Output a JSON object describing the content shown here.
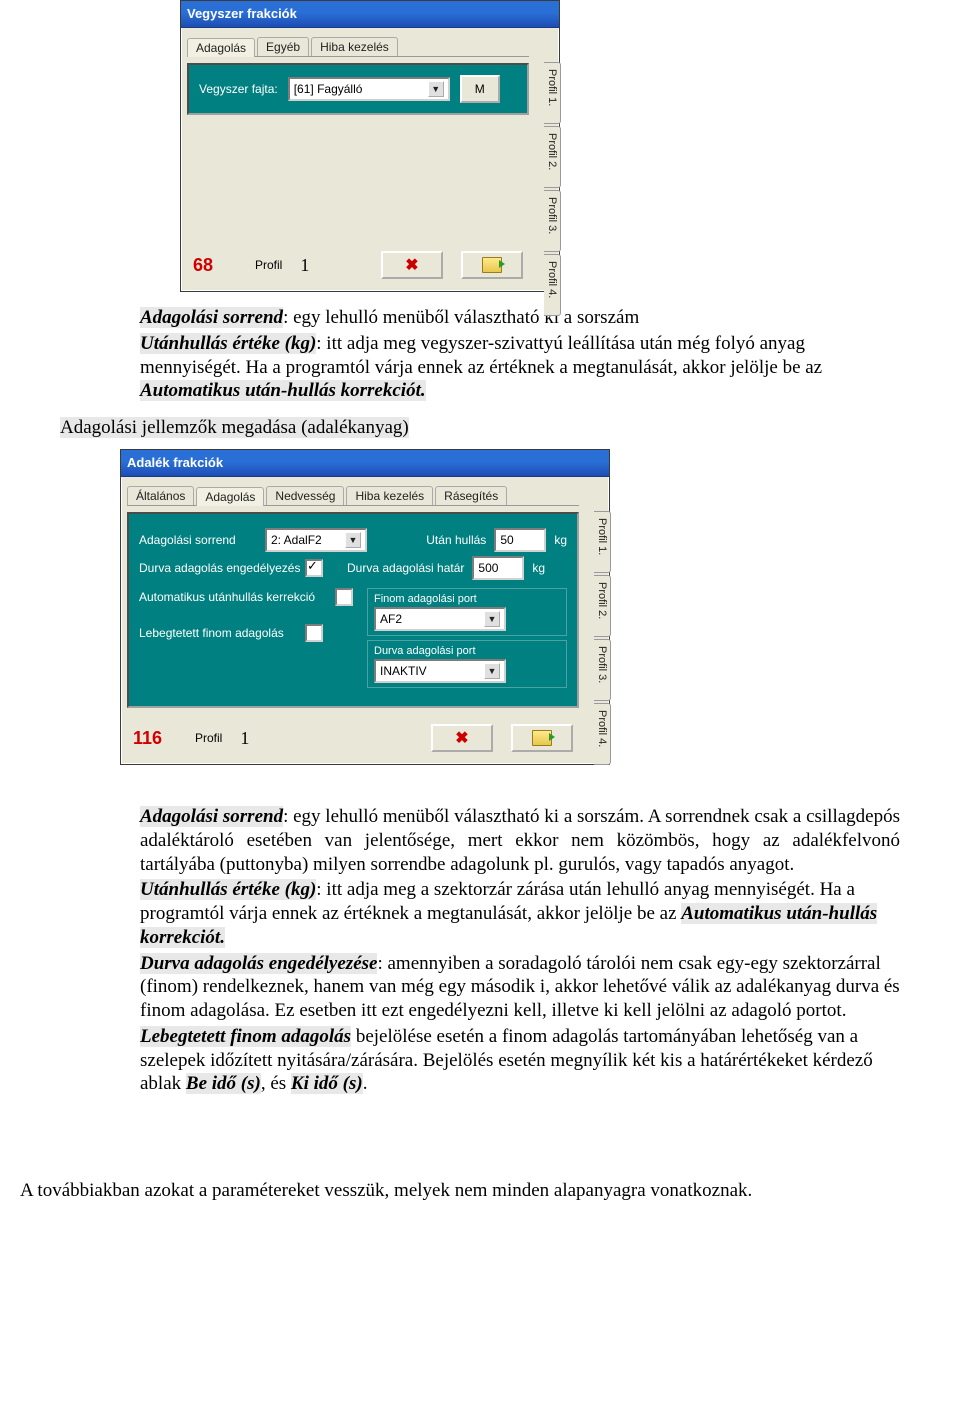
{
  "dialog1": {
    "title": "Vegyszer frakciók",
    "tabs": [
      "Adagolás",
      "Egyéb",
      "Hiba kezelés"
    ],
    "active_tab": 0,
    "field_label": "Vegyszer fajta:",
    "select_value": "[61] Fagyálló",
    "m_button": "M",
    "side_tabs": [
      "Profil 1.",
      "Profil 2.",
      "Profil 3.",
      "Profil 4."
    ],
    "footer_num": "68",
    "footer_profil_label": "Profil",
    "footer_profil_value": "1"
  },
  "para1": {
    "t1a": "Adagolási sorrend",
    "t1b": ": egy lehulló menüből választható ki a sorszám",
    "t2a": "Utánhullás értéke (kg)",
    "t2b": ": itt adja meg vegyszer-szivattyú leállítása után még folyó anyag mennyiségét.",
    "t3a": "Ha a programtól várja ennek az értéknek a megtanulását, akkor jelölje be az ",
    "t3b": "Automatikus után-hullás korrekciót."
  },
  "heading2": "Adagolási jellemzők megadása (adalékanyag)",
  "dialog2": {
    "title": "Adalék frakciók",
    "tabs": [
      "Általános",
      "Adagolás",
      "Nedvesség",
      "Hiba kezelés",
      "Rásegítés"
    ],
    "active_tab": 1,
    "labels": {
      "adag_sorrend": "Adagolási sorrend",
      "utan_hullas": "Után hullás",
      "durva_enged": "Durva adagolás engedélyezés",
      "durva_hatar": "Durva adagolási határ",
      "auto_korr": "Automatikus utánhullás kerrekció",
      "finom_port": "Finom adagolási port",
      "lebeg": "Lebegtetett finom adagolás",
      "durva_port": "Durva adagolási port"
    },
    "values": {
      "sorrend": "2: AdalF2",
      "utan_hullas": "50",
      "utan_hullas_unit": "kg",
      "durva_hatar": "500",
      "durva_hatar_unit": "kg",
      "finom_port": "AF2",
      "durva_port": "INAKTIV",
      "durva_enged_checked": true,
      "auto_korr_checked": false,
      "lebeg_checked": false
    },
    "side_tabs": [
      "Profil 1.",
      "Profil 2.",
      "Profil 3.",
      "Profil 4."
    ],
    "footer_num": "116",
    "footer_profil_label": "Profil",
    "footer_profil_value": "1"
  },
  "para2": {
    "a1": "Adagolási sorrend",
    "a2": ": egy lehulló menüből választható ki a sorszám. A sorrendnek csak a csillagdepós adaléktároló esetében van jelentősége, mert ekkor nem közömbös, hogy az adalékfelvonó tartályába (puttonyba) milyen sorrendbe adagolunk pl. gurulós, vagy tapadós anyagot.",
    "b1": "Utánhullás értéke (kg)",
    "b2": ": itt adja meg a szektorzár zárása után lehulló anyag mennyiségét. Ha a programtól várja ennek az értéknek a megtanulását, akkor jelölje be az ",
    "b3": "Automatikus után-hullás korrekciót.",
    "c1": "Durva adagolás engedélyezése",
    "c2": ": amennyiben a soradagoló tárolói nem csak egy-egy szektorzárral (finom) rendelkeznek, hanem van még egy második i, akkor lehetővé válik az adalékanyag durva és finom adagolása. Ez esetben itt ezt engedélyezni kell, illetve ki kell jelölni az adagoló portot.",
    "d1": "Lebegtetett finom adagolás",
    "d2": " bejelölése esetén a finom adagolás tartományában lehetőség van a szelepek időzített nyitására/zárására. Bejelölés esetén megnyílik két kis a határértékeket kérdező ablak ",
    "d3": "Be idő (s)",
    "d4": ", és ",
    "d5": "Ki idő (s)",
    "d6": "."
  },
  "bottom": "A továbbiakban azokat a paramétereket vesszük, melyek nem minden alapanyagra vonatkoznak."
}
